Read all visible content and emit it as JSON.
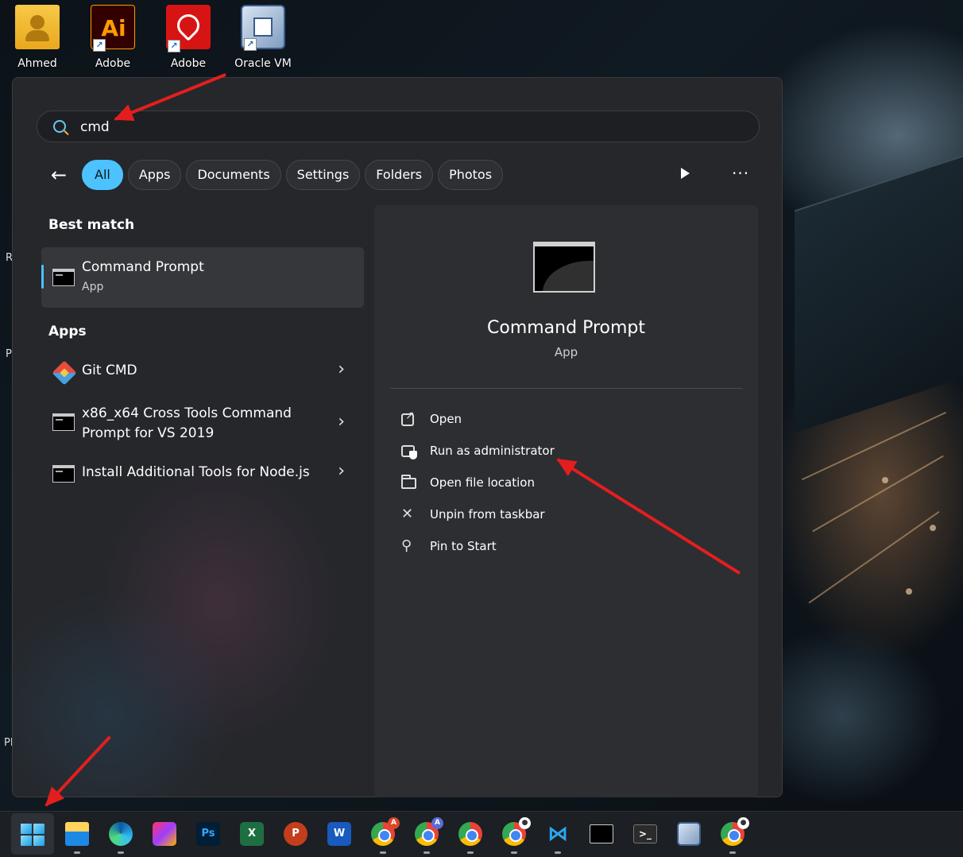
{
  "desktop": {
    "icons": [
      {
        "label": "Ahmed"
      },
      {
        "label": "Adobe",
        "badge": "Ai"
      },
      {
        "label": "Adobe"
      },
      {
        "label": "Oracle VM"
      }
    ],
    "edge_letters": [
      "R",
      "P",
      "Pl"
    ]
  },
  "search": {
    "value": "cmd"
  },
  "filters": {
    "back": "←",
    "chips": [
      "All",
      "Apps",
      "Documents",
      "Settings",
      "Folders",
      "Photos"
    ],
    "more": "···"
  },
  "results": {
    "best_match_title": "Best match",
    "best_match": {
      "name": "Command Prompt",
      "type": "App"
    },
    "apps_title": "Apps",
    "apps": [
      {
        "name": "Git CMD"
      },
      {
        "name_line1": "x86_x64 Cross Tools Command",
        "name_line2": "Prompt for VS 2019"
      },
      {
        "name": "Install Additional Tools for Node.js"
      }
    ],
    "chevron": "›"
  },
  "detail": {
    "title": "Command Prompt",
    "type": "App",
    "actions": [
      "Open",
      "Run as administrator",
      "Open file location",
      "Unpin from taskbar",
      "Pin to Start"
    ]
  },
  "taskbar": {
    "photoshop": "Ps",
    "excel": "X",
    "powerpoint": "P",
    "word": "W",
    "chrome_badge_a": "A",
    "chrome_badge_b": "A"
  },
  "colors": {
    "accent": "#4cc2ff",
    "arrow": "#e41e1e",
    "panel": "#25272b",
    "taskbar": "#1c1f23"
  }
}
